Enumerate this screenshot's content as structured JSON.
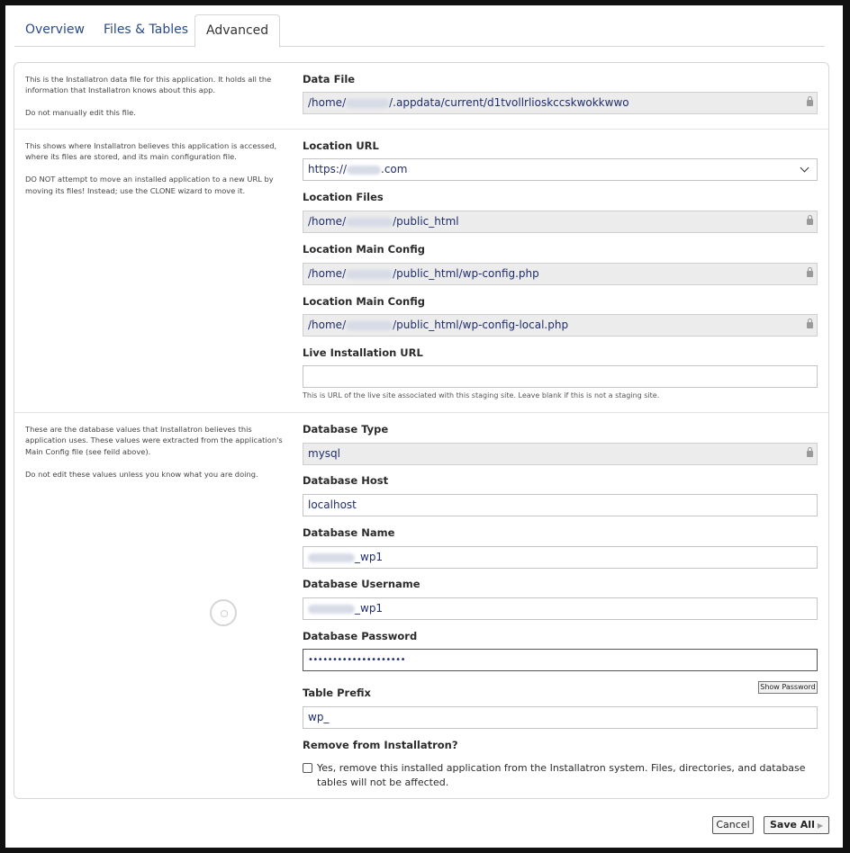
{
  "tabs": [
    {
      "label": "Overview"
    },
    {
      "label": "Files & Tables"
    },
    {
      "label": "Advanced",
      "active": true
    }
  ],
  "data_file": {
    "help": [
      "This is the Installatron data file for this application. It holds all the information that Installatron knows about this app.",
      "Do not manually edit this file."
    ],
    "label": "Data File",
    "value_prefix": "/home/",
    "value_suffix": "/.appdata/current/d1tvollrlioskccskwokkwwo"
  },
  "location": {
    "help": [
      "This shows where Installatron believes this application is accessed, where its files are stored, and its main configuration file.",
      "DO NOT attempt to move an installed application to a new URL by moving its files! Instead; use the CLONE wizard to move it."
    ],
    "url_label": "Location URL",
    "url_prefix": "https://",
    "url_suffix": ".com",
    "files_label": "Location Files",
    "files_prefix": "/home/",
    "files_suffix": "/public_html",
    "config_label": "Location Main Config",
    "config_prefix": "/home/",
    "config_suffix": "/public_html/wp-config.php",
    "config2_label": "Location Main Config",
    "config2_prefix": "/home/",
    "config2_suffix": "/public_html/wp-config-local.php",
    "live_label": "Live Installation URL",
    "live_value": "",
    "live_note": "This is URL of the live site associated with this staging site. Leave blank if this is not a staging site."
  },
  "database": {
    "help": [
      "These are the database values that Installatron believes this application uses. These values were extracted from the application's Main Config file (see feild above).",
      "Do not edit these values unless you know what you are doing."
    ],
    "type_label": "Database Type",
    "type_value": "mysql",
    "host_label": "Database Host",
    "host_value": "localhost",
    "name_label": "Database Name",
    "name_suffix": "_wp1",
    "user_label": "Database Username",
    "user_suffix": "_wp1",
    "password_label": "Database Password",
    "password_value": "••••••••••••••••••••",
    "show_password_label": "Show Password",
    "prefix_label": "Table Prefix",
    "prefix_value": "wp_",
    "remove_label": "Remove from Installatron?",
    "remove_text": "Yes, remove this installed application from the Installatron system. Files, directories, and database tables will not be affected."
  },
  "footer": {
    "cancel_label": "Cancel",
    "save_label": "Save All"
  },
  "icons": [
    "lock-icon",
    "chevron-down-icon",
    "loading-spinner-icon",
    "arrow-right-icon"
  ]
}
